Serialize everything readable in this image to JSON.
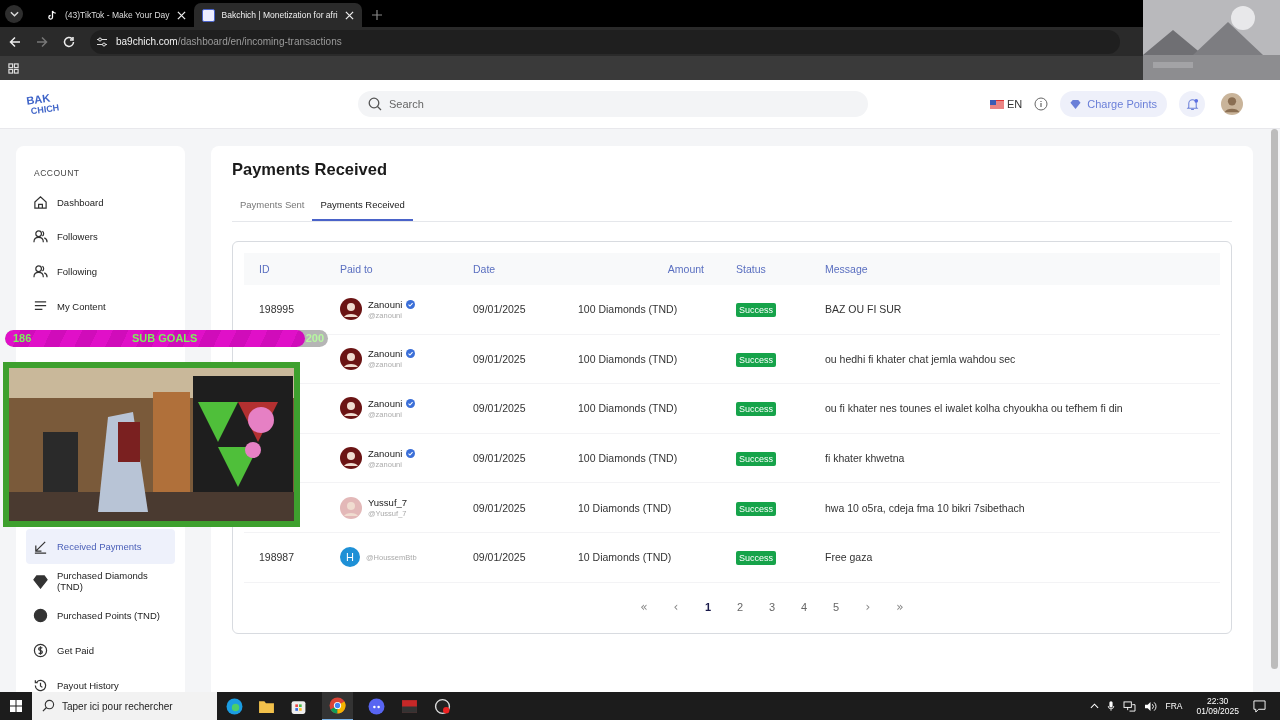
{
  "browser": {
    "tabs": [
      {
        "title": "(43)TikTok - Make Your Day",
        "selected": false
      },
      {
        "title": "Bakchich | Monetization for afri",
        "selected": true
      }
    ],
    "url_host": "ba9chich.com",
    "url_path": "/dashboard/en/incoming-transactions"
  },
  "header": {
    "logo": [
      "BAK",
      "CHICH"
    ],
    "search": {
      "placeholder": "Search"
    },
    "language": "EN",
    "charge_button": "Charge Points",
    "notifications": true
  },
  "sidebar": {
    "section": "ACCOUNT",
    "top_items": [
      {
        "label": "Dashboard",
        "selected": false
      },
      {
        "label": "Followers",
        "selected": false
      },
      {
        "label": "Following",
        "selected": false
      },
      {
        "label": "My Content",
        "selected": false
      }
    ],
    "bottom_items": [
      {
        "label": "Received Payments",
        "selected": true
      },
      {
        "label": "Purchased Diamonds (TND)",
        "selected": false
      },
      {
        "label": "Purchased Points (TND)",
        "selected": false
      },
      {
        "label": "Get Paid",
        "selected": false
      },
      {
        "label": "Payout History",
        "selected": false
      }
    ]
  },
  "main": {
    "title": "Payments Received",
    "tabs": [
      {
        "label": "Payments Sent",
        "selected": false
      },
      {
        "label": "Payments Received",
        "selected": true
      }
    ],
    "table": {
      "columns": [
        "ID",
        "Paid to",
        "Date",
        "Amount",
        "Status",
        "Message"
      ],
      "rows": [
        {
          "id": "198995",
          "name": "Zanouni",
          "handle": "@zanouni",
          "verified": true,
          "date": "09/01/2025",
          "amount": "100 Diamonds (TND)",
          "status": {
            "label": "Success",
            "kind": "success"
          },
          "message": "BAZ OU FI SUR"
        },
        {
          "name": "Zanouni",
          "handle": "@zanouni",
          "verified": true,
          "date": "09/01/2025",
          "amount": "100 Diamonds (TND)",
          "status": {
            "label": "Success",
            "kind": "success"
          },
          "message": "ou hedhi fi khater chat jemla wahdou sec"
        },
        {
          "name": "Zanouni",
          "handle": "@zanouni",
          "verified": true,
          "date": "09/01/2025",
          "amount": "100 Diamonds (TND)",
          "status": {
            "label": "Success",
            "kind": "success"
          },
          "message": "ou fi khater nes tounes el iwalet kolha chyoukha ou tefhem fi din"
        },
        {
          "name": "Zanouni",
          "handle": "@zanouni",
          "verified": true,
          "date": "09/01/2025",
          "amount": "100 Diamonds (TND)",
          "status": {
            "label": "Success",
            "kind": "success"
          },
          "message": "fi khater khwetna"
        },
        {
          "name": "Yussuf_7",
          "handle": "@Yussuf_7",
          "verified": false,
          "date": "09/01/2025",
          "amount": "10 Diamonds (TND)",
          "status": {
            "label": "Success",
            "kind": "success"
          },
          "message": "hwa 10 o5ra, cdeja fma 10 bikri 7sibethach"
        },
        {
          "id": "198987",
          "handle": "@HoussemBtb",
          "verified": false,
          "avatar": {
            "kind": "letter",
            "letter": "H",
            "color": "#1e90d6"
          },
          "date": "09/01/2025",
          "amount": "10 Diamonds (TND)",
          "status": {
            "label": "Success",
            "kind": "success"
          },
          "message": "Free gaza"
        }
      ]
    },
    "pagination": [
      {
        "label": "«",
        "kind": "arrow"
      },
      {
        "label": "‹",
        "kind": "arrow"
      },
      {
        "label": "1",
        "kind": "page",
        "selected": true
      },
      {
        "label": "2",
        "kind": "page",
        "selected": false
      },
      {
        "label": "3",
        "kind": "page",
        "selected": false
      },
      {
        "label": "4",
        "kind": "page",
        "selected": false
      },
      {
        "label": "5",
        "kind": "page",
        "selected": false
      },
      {
        "label": "›",
        "kind": "arrow"
      },
      {
        "label": "»",
        "kind": "arrow"
      }
    ]
  },
  "stream_overlay": {
    "goal_current": "186",
    "goal_label": "SUB GOALS",
    "goal_target": "200",
    "level": 0.93
  },
  "taskbar": {
    "search": {
      "placeholder": "Taper ici pour rechercher"
    },
    "language": "FRA",
    "time": "22:30",
    "date": "01/09/2025"
  }
}
